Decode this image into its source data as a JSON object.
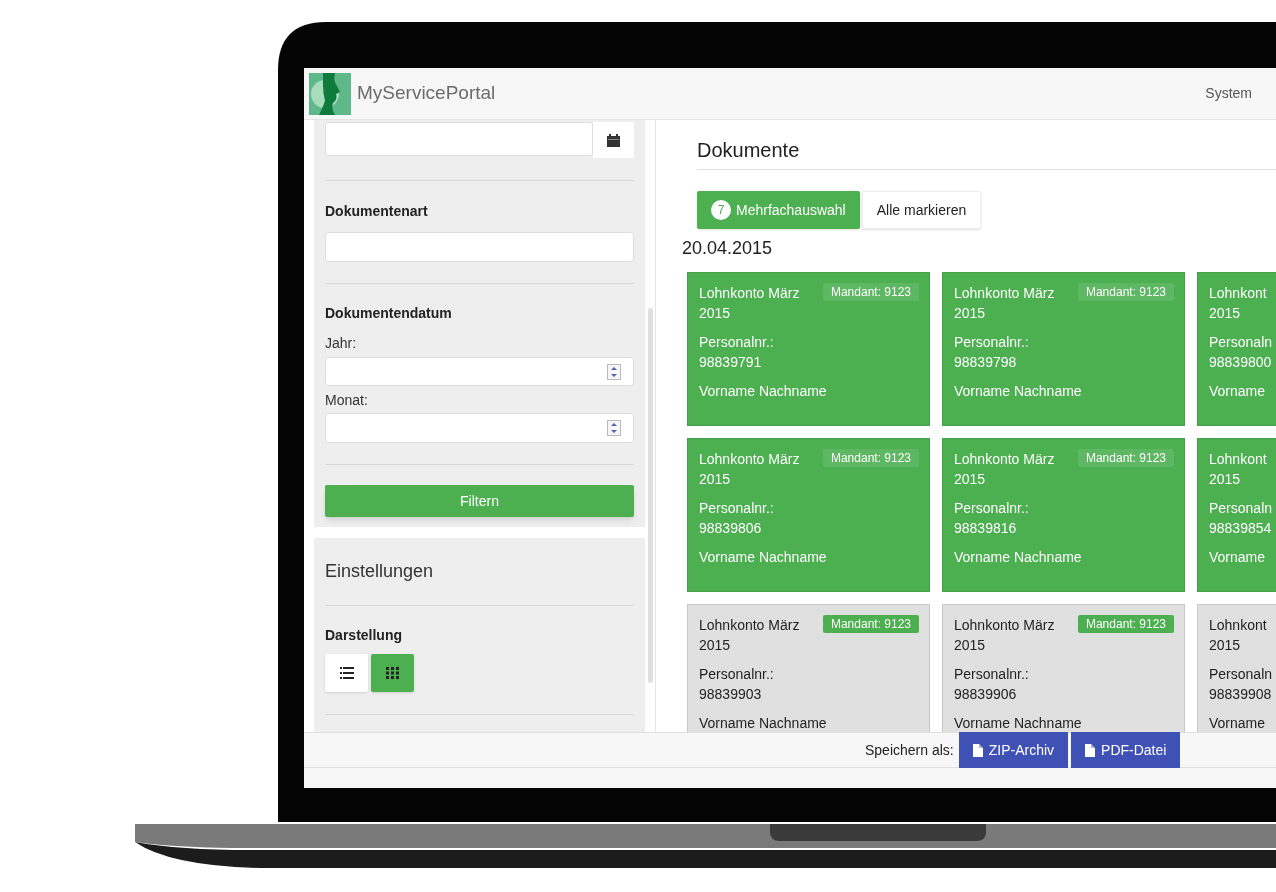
{
  "app": {
    "title": "MyServicePortal",
    "menu": "System"
  },
  "filter": {
    "doc_type_label": "Dokumentenart",
    "date_label": "Dokumentendatum",
    "year_label": "Jahr:",
    "month_label": "Monat:",
    "button": "Filtern"
  },
  "settings": {
    "title": "Einstellungen",
    "display_label": "Darstellung",
    "views": [
      {
        "kind": "list",
        "selected": false
      },
      {
        "kind": "grid",
        "selected": true
      }
    ]
  },
  "documents": {
    "title": "Dokumente",
    "multi_select": {
      "count": "7",
      "label": "Mehrfachauswahl"
    },
    "mark_all": "Alle markieren",
    "date": "20.04.2015",
    "cards": [
      {
        "title": "Lohnkonto März 2015",
        "badge": "Mandant: 9123",
        "number_label": "Personalnr.:",
        "number": "98839791",
        "name": "Vorname Nachname",
        "selected": true
      },
      {
        "title": "Lohnkonto März 2015",
        "badge": "Mandant: 9123",
        "number_label": "Personalnr.:",
        "number": "98839798",
        "name": "Vorname Nachname",
        "selected": true
      },
      {
        "title": "Lohnkont 2015",
        "number_label": "Personaln",
        "number": "98839800",
        "name": "Vorname",
        "selected": true
      },
      {
        "title": "Lohnkonto März 2015",
        "badge": "Mandant: 9123",
        "number_label": "Personalnr.:",
        "number": "98839806",
        "name": "Vorname Nachname",
        "selected": true
      },
      {
        "title": "Lohnkonto März 2015",
        "badge": "Mandant: 9123",
        "number_label": "Personalnr.:",
        "number": "98839816",
        "name": "Vorname Nachname",
        "selected": true
      },
      {
        "title": "Lohnkont 2015",
        "number_label": "Personaln",
        "number": "98839854",
        "name": "Vorname",
        "selected": true
      },
      {
        "title": "Lohnkonto März 2015",
        "badge": "Mandant: 9123",
        "number_label": "Personalnr.:",
        "number": "98839903",
        "name": "Vorname Nachname",
        "selected": false
      },
      {
        "title": "Lohnkonto März 2015",
        "badge": "Mandant: 9123",
        "number_label": "Personalnr.:",
        "number": "98839906",
        "name": "Vorname Nachname",
        "selected": false
      },
      {
        "title": "Lohnkont 2015",
        "number_label": "Personaln",
        "number": "98839908",
        "name": "Vorname",
        "selected": false
      }
    ]
  },
  "footer": {
    "label": "Speichern als:",
    "buttons": [
      "ZIP-Archiv",
      "PDF-Datei"
    ]
  }
}
